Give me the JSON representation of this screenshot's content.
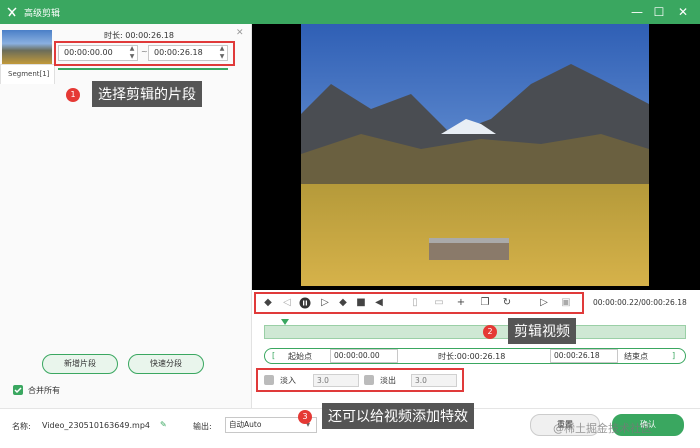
{
  "window": {
    "title": "高级剪辑",
    "accent": "#3aa760"
  },
  "segment": {
    "duration_label": "时长:",
    "duration_value": "00:00:26.18",
    "start_time": "00:00:00.00",
    "end_time": "00:00:26.18",
    "tab_label": "Segment[1]"
  },
  "callouts": {
    "one": {
      "num": "1",
      "text": "选择剪辑的片段"
    },
    "two": {
      "num": "2",
      "text": "剪辑视频"
    },
    "three": {
      "num": "3",
      "text": "还可以给视频添加特效"
    }
  },
  "left_buttons": {
    "add_segment": "新增片段",
    "quick_split": "快速分段",
    "merge_all": "合并所有"
  },
  "player": {
    "time_readout": "00:00:00.22/00:00:26.18"
  },
  "trim": {
    "start_point": "起始点",
    "start_value": "00:00:00.00",
    "duration_label": "时长:",
    "duration_value": "00:00:26.18",
    "end_value": "00:00:26.18",
    "end_point": "结束点"
  },
  "effects": {
    "fade_in": "淡入",
    "fade_in_value": "3.0",
    "fade_out": "淡出",
    "fade_out_value": "3.0"
  },
  "bottom": {
    "name_label": "名称:",
    "file_name": "Video_230510163649.mp4",
    "output_label": "输出:",
    "output_value": "自动Auto",
    "reset_button": "重置",
    "confirm_button": "确认",
    "watermark": "@稀土掘金技术社区"
  },
  "icons": [
    "app-icon",
    "minimize-icon",
    "maximize-icon",
    "close-icon",
    "pencil-icon",
    "chevron-down-icon"
  ]
}
